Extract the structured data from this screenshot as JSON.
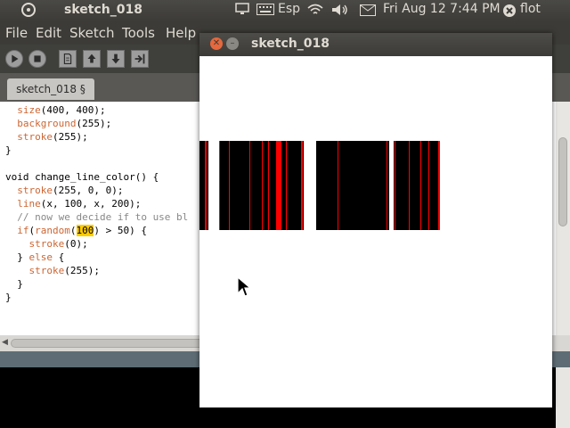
{
  "top_panel": {
    "app_title": "sketch_018",
    "keyboard": "Esp",
    "datetime": "Fri Aug 12  7:44 PM",
    "user": "flot"
  },
  "menubar": {
    "file": "File",
    "edit": "Edit",
    "sketch": "Sketch",
    "tools": "Tools",
    "help": "Help"
  },
  "toolbar": {
    "run": "run-icon",
    "stop": "stop-icon",
    "new": "new-icon",
    "open": "open-icon",
    "save": "save-icon",
    "export": "export-icon"
  },
  "tab": {
    "label": "sketch_018 §"
  },
  "code": [
    "  size(400, 400);",
    "  background(255);",
    "  stroke(255);",
    "}",
    "",
    "void change_line_color() {",
    "  stroke(255, 0, 0);",
    "  line(x, 100, x, 200);",
    "  // now we decide if to use bl",
    "  if(random(100) > 50) {",
    "    stroke(0);",
    "  } else {",
    "    stroke(255);",
    "  }",
    "}"
  ],
  "sketch_window": {
    "title": "sketch_018"
  },
  "colors": {
    "panel_bg": "#3c3b37",
    "line_red": "#ff0000",
    "line_black": "#000000",
    "keyword": "#cc6633"
  }
}
